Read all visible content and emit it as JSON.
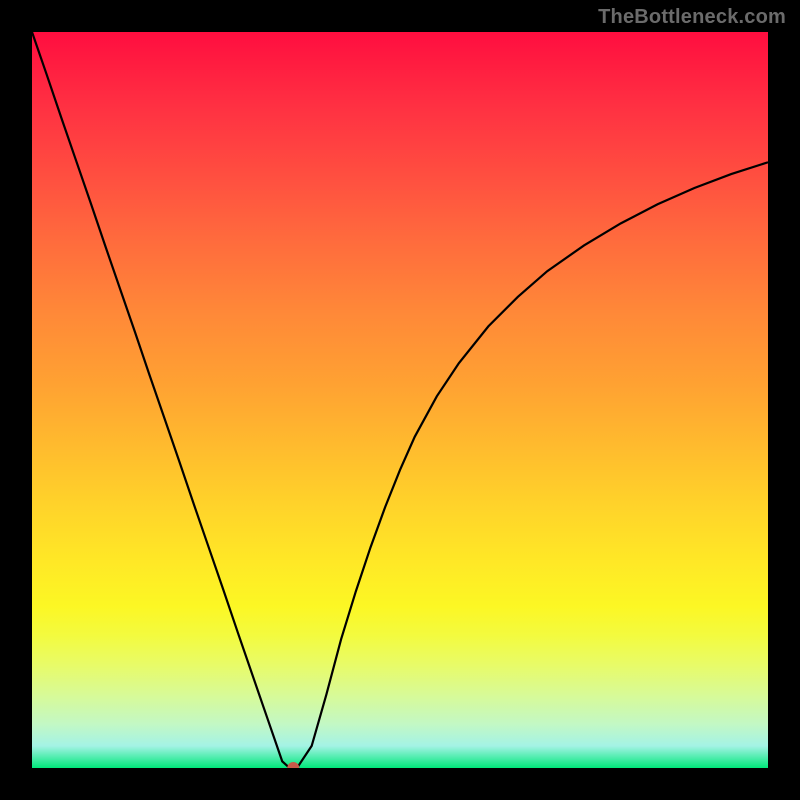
{
  "watermark": "TheBottleneck.com",
  "chart_data": {
    "type": "line",
    "title": "",
    "xlabel": "",
    "ylabel": "",
    "xlim": [
      0,
      100
    ],
    "ylim": [
      0,
      100
    ],
    "x": [
      0,
      2,
      4,
      6,
      8,
      10,
      12,
      14,
      16,
      18,
      20,
      22,
      24,
      26,
      28,
      30,
      31,
      32,
      33,
      34,
      35,
      36,
      38,
      40,
      42,
      44,
      46,
      48,
      50,
      52,
      55,
      58,
      62,
      66,
      70,
      75,
      80,
      85,
      90,
      95,
      100
    ],
    "y": [
      100,
      94.2,
      88.3,
      82.5,
      76.7,
      70.8,
      65.0,
      59.2,
      53.3,
      47.5,
      41.7,
      35.8,
      30.0,
      24.2,
      18.3,
      12.5,
      9.6,
      6.7,
      3.8,
      0.9,
      0.0,
      0.0,
      3.0,
      10.0,
      17.5,
      24.0,
      30.0,
      35.5,
      40.5,
      45.0,
      50.5,
      55.0,
      60.0,
      64.0,
      67.5,
      71.0,
      74.0,
      76.6,
      78.8,
      80.7,
      82.3
    ],
    "marker": {
      "x": 35.5,
      "y": 0.0
    }
  }
}
